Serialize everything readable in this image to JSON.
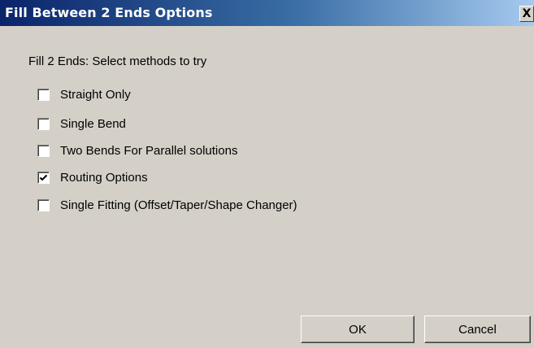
{
  "window": {
    "title": "Fill Between 2 Ends Options",
    "close_glyph": "X"
  },
  "main": {
    "prompt": "Fill 2 Ends: Select methods to try",
    "options": [
      {
        "label": "Straight Only",
        "checked": false
      },
      {
        "label": "Single Bend",
        "checked": false
      },
      {
        "label": "Two Bends For Parallel solutions",
        "checked": false
      },
      {
        "label": "Routing Options",
        "checked": true
      },
      {
        "label": "Single Fitting (Offset/Taper/Shape Changer)",
        "checked": false
      }
    ]
  },
  "buttons": {
    "ok_label": "OK",
    "cancel_label": "Cancel"
  },
  "colors": {
    "face": "#d4d0c8",
    "title_start": "#0a246a",
    "title_end": "#a6caf0"
  }
}
